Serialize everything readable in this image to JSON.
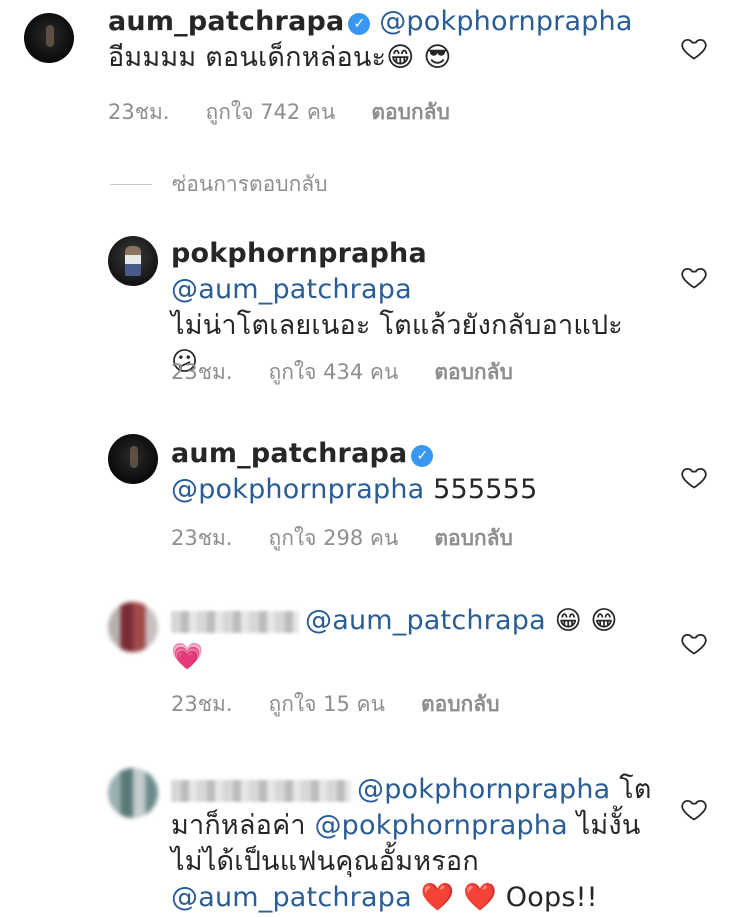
{
  "comments": [
    {
      "username": "aum_patchrapa",
      "verified": true,
      "mention": "@pokphornprapha",
      "text_lines": [
        "อีมมมม ตอนเด็กหล่อนะ😁 😎"
      ],
      "time": "23ชม.",
      "likes": "ถูกใจ 742 คน",
      "reply": "ตอบกลับ"
    },
    {
      "username": "pokphornprapha",
      "verified": false,
      "mention": "@aum_patchrapa",
      "text_lines": [
        "ไม่น่าโตเลยเนอะ โตแล้วยังกลับอาแปะ",
        "😕"
      ],
      "time": "23ชม.",
      "likes": "ถูกใจ 434 คน",
      "reply": "ตอบกลับ"
    },
    {
      "username": "aum_patchrapa",
      "verified": true,
      "mention": "@pokphornprapha",
      "text_tail": " 555555",
      "time": "23ชม.",
      "likes": "ถูกใจ 298 คน",
      "reply": "ตอบกลับ"
    },
    {
      "mention": "@aum_patchrapa",
      "emojis": "😁 😁",
      "line2": "💗",
      "time": "23ชม.",
      "likes": "ถูกใจ 15 คน",
      "reply": "ตอบกลับ"
    },
    {
      "mention1": "@pokphornprapha",
      "tail1": " โต",
      "line2_prefix": "มาก็หล่อค่า ",
      "mention2": "@pokphornprapha",
      "line2_suffix": " ไม่งั้น",
      "line3": "ไม่ได้เป็นแฟนคุณอั้มหรอก",
      "mention3": "@aum_patchrapa",
      "line4_tail": " ❤️ ❤️  Oops!!"
    }
  ],
  "hide_replies_label": "ซ่อนการตอบกลับ",
  "colors": {
    "mention": "#2a5d95",
    "meta": "#8e8e8e",
    "verified": "#3897f0",
    "text": "#262626"
  },
  "icons": {
    "heart": "heart-outline-icon",
    "verified": "verified-badge-icon"
  }
}
